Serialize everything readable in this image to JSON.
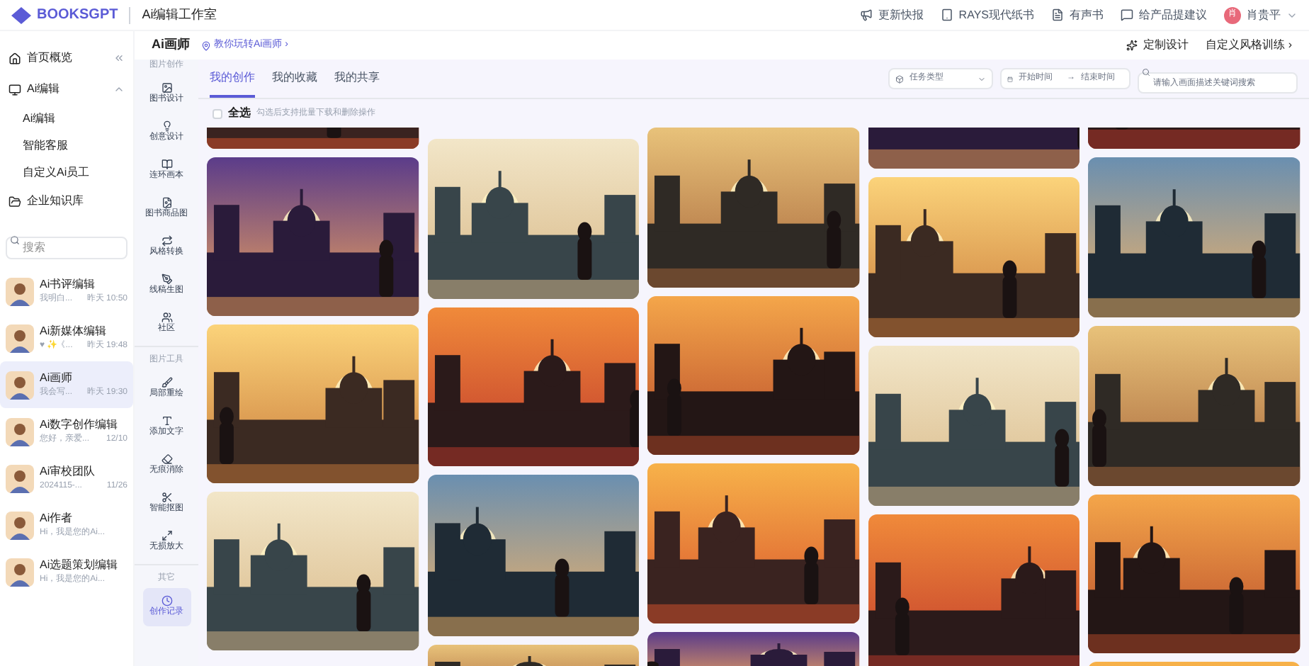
{
  "brand": {
    "name": "BOOKSGPT",
    "product": "Ai编辑工作室"
  },
  "top_links": [
    "更新快报",
    "RAYS现代纸书",
    "有声书",
    "给产品提建议"
  ],
  "user": {
    "name": "肖贵平",
    "initials": "肖"
  },
  "nav": [
    {
      "label": "首页概览"
    },
    {
      "label": "Ai编辑",
      "expanded": true,
      "children": [
        {
          "label": "Ai编辑"
        },
        {
          "label": "智能客服"
        },
        {
          "label": "自定义Ai员工"
        }
      ]
    },
    {
      "label": "企业知识库"
    }
  ],
  "search": {
    "placeholder": "搜索"
  },
  "chats": [
    {
      "name": "Ai书评编辑",
      "preview": "我明白...",
      "time": "昨天 10:50",
      "selected": false
    },
    {
      "name": "Ai新媒体编辑",
      "preview": "♥ ✨《...",
      "time": "昨天 19:48",
      "selected": false
    },
    {
      "name": "Ai画师",
      "preview": "我会写...",
      "time": "昨天 19:30",
      "selected": true
    },
    {
      "name": "Ai数字创作编辑",
      "preview": "您好，亲爱...",
      "time": "12/10",
      "selected": false
    },
    {
      "name": "Ai审校团队",
      "preview": "2024115-...",
      "time": "11/26",
      "selected": false
    },
    {
      "name": "Ai作者",
      "preview": "Hi，我是您的Ai...",
      "selected": false
    },
    {
      "name": "Ai选题策划编辑",
      "preview": "Hi，我是您的Ai...",
      "selected": false
    }
  ],
  "page": {
    "title": "Ai画师",
    "guide_link": "教你玩转Ai画师 ›",
    "actions": [
      "定制设计",
      "自定义风格训练 ›"
    ]
  },
  "tool_groups": [
    {
      "title": "图片创作",
      "items": [
        {
          "label": "图书设计",
          "selected": false
        },
        {
          "label": "创意设计",
          "selected": false
        },
        {
          "label": "连环画本",
          "selected": false
        },
        {
          "label": "图书商品图",
          "selected": false
        },
        {
          "label": "风格转换",
          "selected": false
        },
        {
          "label": "线稿生图",
          "selected": false
        },
        {
          "label": "社区",
          "selected": false
        }
      ]
    },
    {
      "title": "图片工具",
      "items": [
        {
          "label": "局部重绘",
          "selected": false
        },
        {
          "label": "添加文字",
          "selected": false
        },
        {
          "label": "无痕消除",
          "selected": false
        },
        {
          "label": "智能抠图",
          "selected": false
        },
        {
          "label": "无损放大",
          "selected": false
        }
      ]
    },
    {
      "title": "其它",
      "items": [
        {
          "label": "创作记录",
          "selected": true
        }
      ]
    }
  ],
  "tabs": [
    {
      "label": "我的创作",
      "selected": true
    },
    {
      "label": "我的收藏",
      "selected": false
    },
    {
      "label": "我的共享",
      "selected": false
    }
  ],
  "filters": {
    "task_type": {
      "placeholder": "任务类型"
    },
    "start": {
      "placeholder": "开始时间"
    },
    "separator": "→",
    "end": {
      "placeholder": "结束时间"
    },
    "keyword": {
      "placeholder": "请输入画面描述关键词搜索"
    }
  },
  "select_all": {
    "label": "全选",
    "checked": false,
    "hint": "勾选后支持批量下载和删除操作"
  },
  "gallery": [
    {
      "kind": "picture"
    }
  ]
}
